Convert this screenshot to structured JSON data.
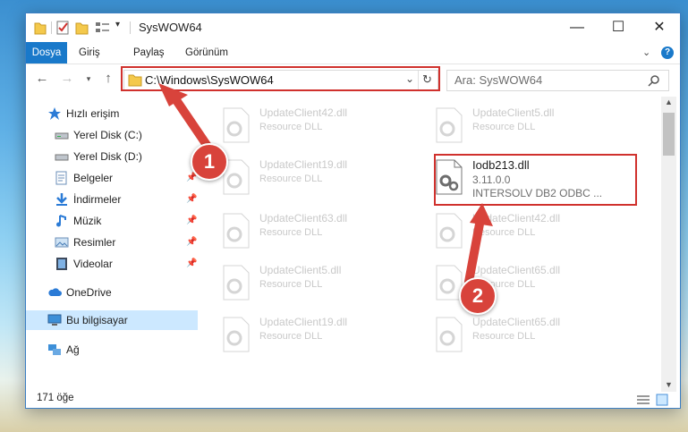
{
  "window": {
    "title": "SysWOW64",
    "minimize_glyph": "—",
    "maximize_glyph": "☐",
    "close_glyph": "✕"
  },
  "ribbon": {
    "file_tab": "Dosya",
    "tabs": [
      "Giriş",
      "Paylaş",
      "Görünüm"
    ],
    "help_glyph": "?"
  },
  "nav": {
    "address": "C:\\Windows\\SysWOW64",
    "search_placeholder": "Ara: SysWOW64"
  },
  "sidebar": {
    "items": [
      {
        "label": "Hızlı erişim",
        "icon": "star-icon"
      },
      {
        "label": "Yerel Disk (C:)",
        "icon": "drive-icon"
      },
      {
        "label": "Yerel Disk (D:)",
        "icon": "drive-icon"
      },
      {
        "label": "Belgeler",
        "icon": "documents-icon"
      },
      {
        "label": "İndirmeler",
        "icon": "download-icon"
      },
      {
        "label": "Müzik",
        "icon": "music-icon"
      },
      {
        "label": "Resimler",
        "icon": "pictures-icon"
      },
      {
        "label": "Videolar",
        "icon": "video-icon"
      },
      {
        "label": "OneDrive",
        "icon": "cloud-icon"
      },
      {
        "label": "Bu bilgisayar",
        "icon": "computer-icon"
      },
      {
        "label": "Ağ",
        "icon": "network-icon"
      }
    ]
  },
  "files": {
    "left": [
      {
        "name": "UpdateClient42.dll",
        "type": "Resource DLL"
      },
      {
        "name": "UpdateClient19.dll",
        "type": "Resource DLL"
      },
      {
        "name": "UpdateClient63.dll",
        "type": "Resource DLL"
      },
      {
        "name": "UpdateClient5.dll",
        "type": "Resource DLL"
      },
      {
        "name": "UpdateClient19.dll",
        "type": "Resource DLL"
      }
    ],
    "right": [
      {
        "name": "UpdateClient5.dll",
        "type": "Resource DLL"
      },
      {
        "name": "UpdateClient42.dll",
        "type": "Resource DLL"
      },
      {
        "name": "UpdateClient65.dll",
        "type": "Resource DLL"
      },
      {
        "name": "UpdateClient65.dll",
        "type": "Resource DLL"
      }
    ],
    "highlighted": {
      "name": "Iodb213.dll",
      "version": "3.11.0.0",
      "description": "INTERSOLV DB2 ODBC ..."
    }
  },
  "status": {
    "count": "171 öğe"
  },
  "annotations": {
    "badge1": "1",
    "badge2": "2",
    "accent_color": "#d0312d"
  }
}
